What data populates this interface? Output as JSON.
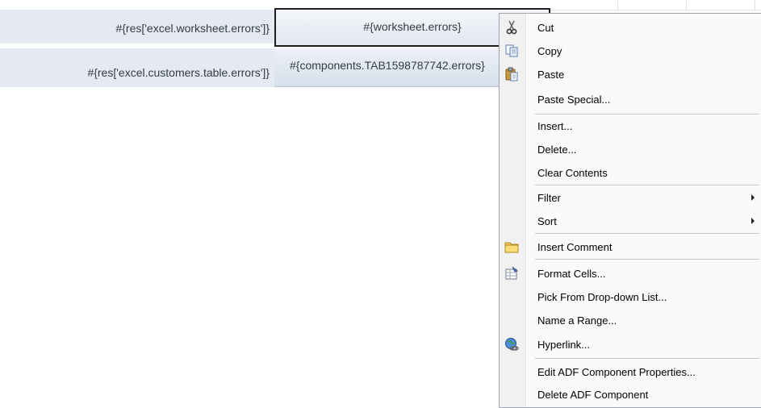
{
  "cells": {
    "label1": "#{res['excel.worksheet.errors']}",
    "label2": "#{res['excel.customers.table.errors']}",
    "value1": "#{worksheet.errors}",
    "value2": "#{components.TAB1598787742.errors}"
  },
  "context_menu": {
    "items": [
      {
        "id": "cut",
        "label": "Cut",
        "icon": "scissors-icon"
      },
      {
        "id": "copy",
        "label": "Copy",
        "icon": "copy-icon"
      },
      {
        "id": "paste",
        "label": "Paste",
        "icon": "clipboard-paste-icon"
      },
      {
        "id": "paste-special",
        "label": "Paste Special..."
      },
      {
        "id": "insert",
        "label": "Insert..."
      },
      {
        "id": "delete",
        "label": "Delete..."
      },
      {
        "id": "clear-contents",
        "label": "Clear Contents"
      },
      {
        "id": "filter",
        "label": "Filter",
        "submenu": true
      },
      {
        "id": "sort",
        "label": "Sort",
        "submenu": true
      },
      {
        "id": "insert-comment",
        "label": "Insert Comment",
        "icon": "comment-folder-icon"
      },
      {
        "id": "format-cells",
        "label": "Format Cells...",
        "icon": "format-cells-icon"
      },
      {
        "id": "pick-dropdown",
        "label": "Pick From Drop-down List..."
      },
      {
        "id": "name-range",
        "label": "Name a Range..."
      },
      {
        "id": "hyperlink",
        "label": "Hyperlink...",
        "icon": "hyperlink-globe-icon"
      },
      {
        "id": "edit-adf",
        "label": "Edit ADF Component Properties..."
      },
      {
        "id": "delete-adf",
        "label": "Delete ADF Component"
      }
    ]
  }
}
